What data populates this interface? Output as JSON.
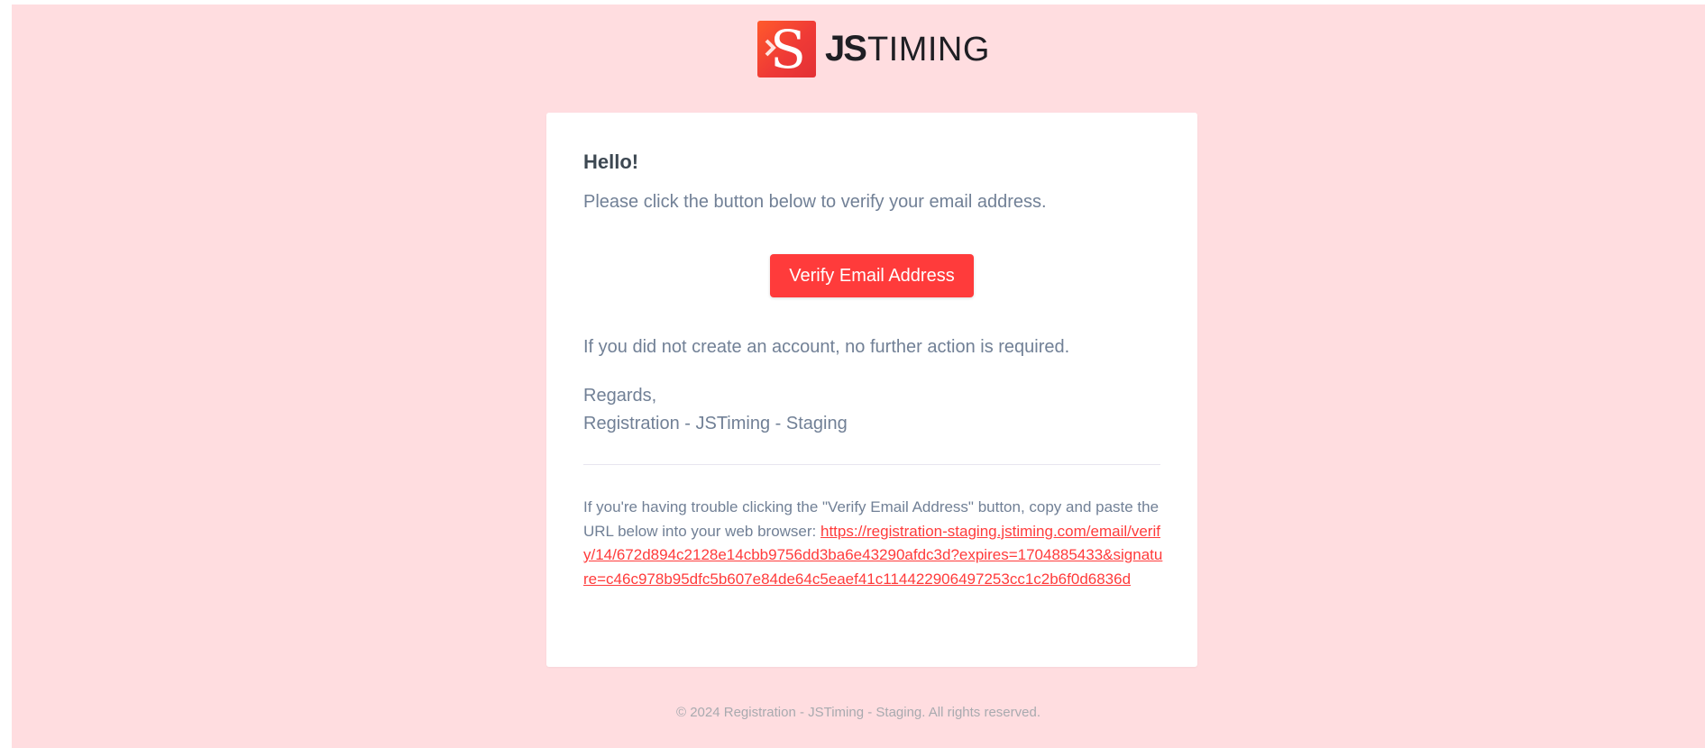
{
  "brand": {
    "logo_letter": "S",
    "logo_bold": "JS",
    "logo_light": "TIMING",
    "accent_color": "#ff3b3b",
    "background_color": "#ffdde0"
  },
  "email": {
    "greeting": "Hello!",
    "intro": "Please click the button below to verify your email address.",
    "button_label": "Verify Email Address",
    "no_action": "If you did not create an account, no further action is required.",
    "salutation": "Regards,",
    "signature": "Registration - JSTiming - Staging",
    "subcopy_text": "If you're having trouble clicking the \"Verify Email Address\" button, copy and paste the URL below into your web browser: ",
    "verify_url": "https://registration-staging.jstiming.com/email/verify/14/672d894c2128e14cbb9756dd3ba6e43290afdc3d?expires=1704885433&signature=c46c978b95dfc5b607e84de64c5eaef41c114422906497253cc1c2b6f0d6836d"
  },
  "footer": {
    "copyright": "© 2024 Registration - JSTiming - Staging. All rights reserved."
  }
}
